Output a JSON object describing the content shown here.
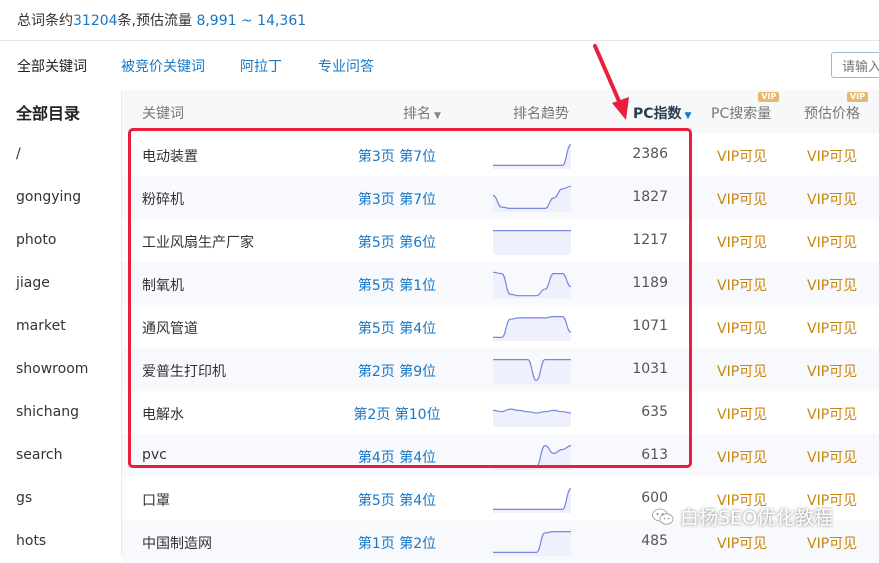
{
  "summary": {
    "prefix": "总词条约",
    "count": "31204",
    "middle": "条,预估流量 ",
    "flow": "8,991 ~ 14,361"
  },
  "tabs": [
    {
      "label": "全部关键词"
    },
    {
      "label": "被竞价关键词"
    },
    {
      "label": "阿拉丁"
    },
    {
      "label": "专业问答"
    }
  ],
  "search": {
    "placeholder": "请输入"
  },
  "sidebar": {
    "title": "全部目录",
    "items": [
      {
        "label": "/"
      },
      {
        "label": "gongying"
      },
      {
        "label": "photo"
      },
      {
        "label": "jiage"
      },
      {
        "label": "market"
      },
      {
        "label": "showroom"
      },
      {
        "label": "shichang"
      },
      {
        "label": "search"
      },
      {
        "label": "gs"
      },
      {
        "label": "hots"
      }
    ]
  },
  "columns": {
    "keyword": "关键词",
    "rank": "排名",
    "trend": "排名趋势",
    "pc_index": "PC指数",
    "pc_search": "PC搜索量",
    "price": "预估价格",
    "vip_badge": "VIP"
  },
  "rows": [
    {
      "keyword": "电动装置",
      "rank": "第3页 第7位",
      "pc": "2386",
      "vip1": "VIP可见",
      "vip2": "VIP可见",
      "trend": [
        0.1,
        0.1,
        0.1,
        0.1,
        0.1,
        0.1,
        0.1,
        0.1,
        0.1,
        0.9
      ]
    },
    {
      "keyword": "粉碎机",
      "rank": "第3页 第7位",
      "pc": "1827",
      "vip1": "VIP可见",
      "vip2": "VIP可见",
      "trend": [
        0.6,
        0.15,
        0.1,
        0.1,
        0.1,
        0.1,
        0.1,
        0.5,
        0.85,
        0.95
      ]
    },
    {
      "keyword": "工业风扇生产厂家",
      "rank": "第5页 第6位",
      "pc": "1217",
      "vip1": "VIP可见",
      "vip2": "VIP可见",
      "trend": [
        0.9,
        0.9,
        0.9,
        0.9,
        0.9,
        0.9,
        0.9,
        0.9,
        0.9,
        0.9
      ]
    },
    {
      "keyword": "制氧机",
      "rank": "第5页 第1位",
      "pc": "1189",
      "vip1": "VIP可见",
      "vip2": "VIP可见",
      "trend": [
        0.95,
        0.9,
        0.1,
        0.05,
        0.05,
        0.05,
        0.3,
        0.9,
        0.9,
        0.4
      ]
    },
    {
      "keyword": "通风管道",
      "rank": "第5页 第4位",
      "pc": "1071",
      "vip1": "VIP可见",
      "vip2": "VIP可见",
      "trend": [
        0.1,
        0.1,
        0.8,
        0.85,
        0.85,
        0.85,
        0.85,
        0.9,
        0.9,
        0.3
      ]
    },
    {
      "keyword": "爱普生打印机",
      "rank": "第2页 第9位",
      "pc": "1031",
      "vip1": "VIP可见",
      "vip2": "VIP可见",
      "trend": [
        0.9,
        0.9,
        0.9,
        0.9,
        0.9,
        0.1,
        0.9,
        0.9,
        0.9,
        0.9
      ]
    },
    {
      "keyword": "电解水",
      "rank": "第2页 第10位",
      "pc": "635",
      "vip1": "VIP可见",
      "vip2": "VIP可见",
      "trend": [
        0.6,
        0.55,
        0.65,
        0.6,
        0.55,
        0.5,
        0.55,
        0.6,
        0.55,
        0.5
      ]
    },
    {
      "keyword": "pvc",
      "rank": "第4页 第4位",
      "pc": "613",
      "vip1": "VIP可见",
      "vip2": "VIP可见",
      "trend": [
        0.1,
        0.1,
        0.1,
        0.1,
        0.1,
        0.1,
        0.9,
        0.6,
        0.75,
        0.9
      ]
    },
    {
      "keyword": "口罩",
      "rank": "第5页 第4位",
      "pc": "600",
      "vip1": "VIP可见",
      "vip2": "VIP可见",
      "trend": [
        0.1,
        0.1,
        0.1,
        0.1,
        0.1,
        0.1,
        0.1,
        0.1,
        0.1,
        0.9
      ]
    },
    {
      "keyword": "中国制造网",
      "rank": "第1页 第2位",
      "pc": "485",
      "vip1": "VIP可见",
      "vip2": "VIP可见",
      "trend": [
        0.1,
        0.1,
        0.1,
        0.1,
        0.1,
        0.1,
        0.85,
        0.9,
        0.9,
        0.9
      ]
    }
  ],
  "watermark": {
    "text": "白杨SEO优化教程"
  },
  "colors": {
    "accent": "#1677c6",
    "vip": "#c8860d",
    "highlight": "#e8203c",
    "trend_line": "#7b86e0",
    "trend_fill": "#eef0fb"
  }
}
